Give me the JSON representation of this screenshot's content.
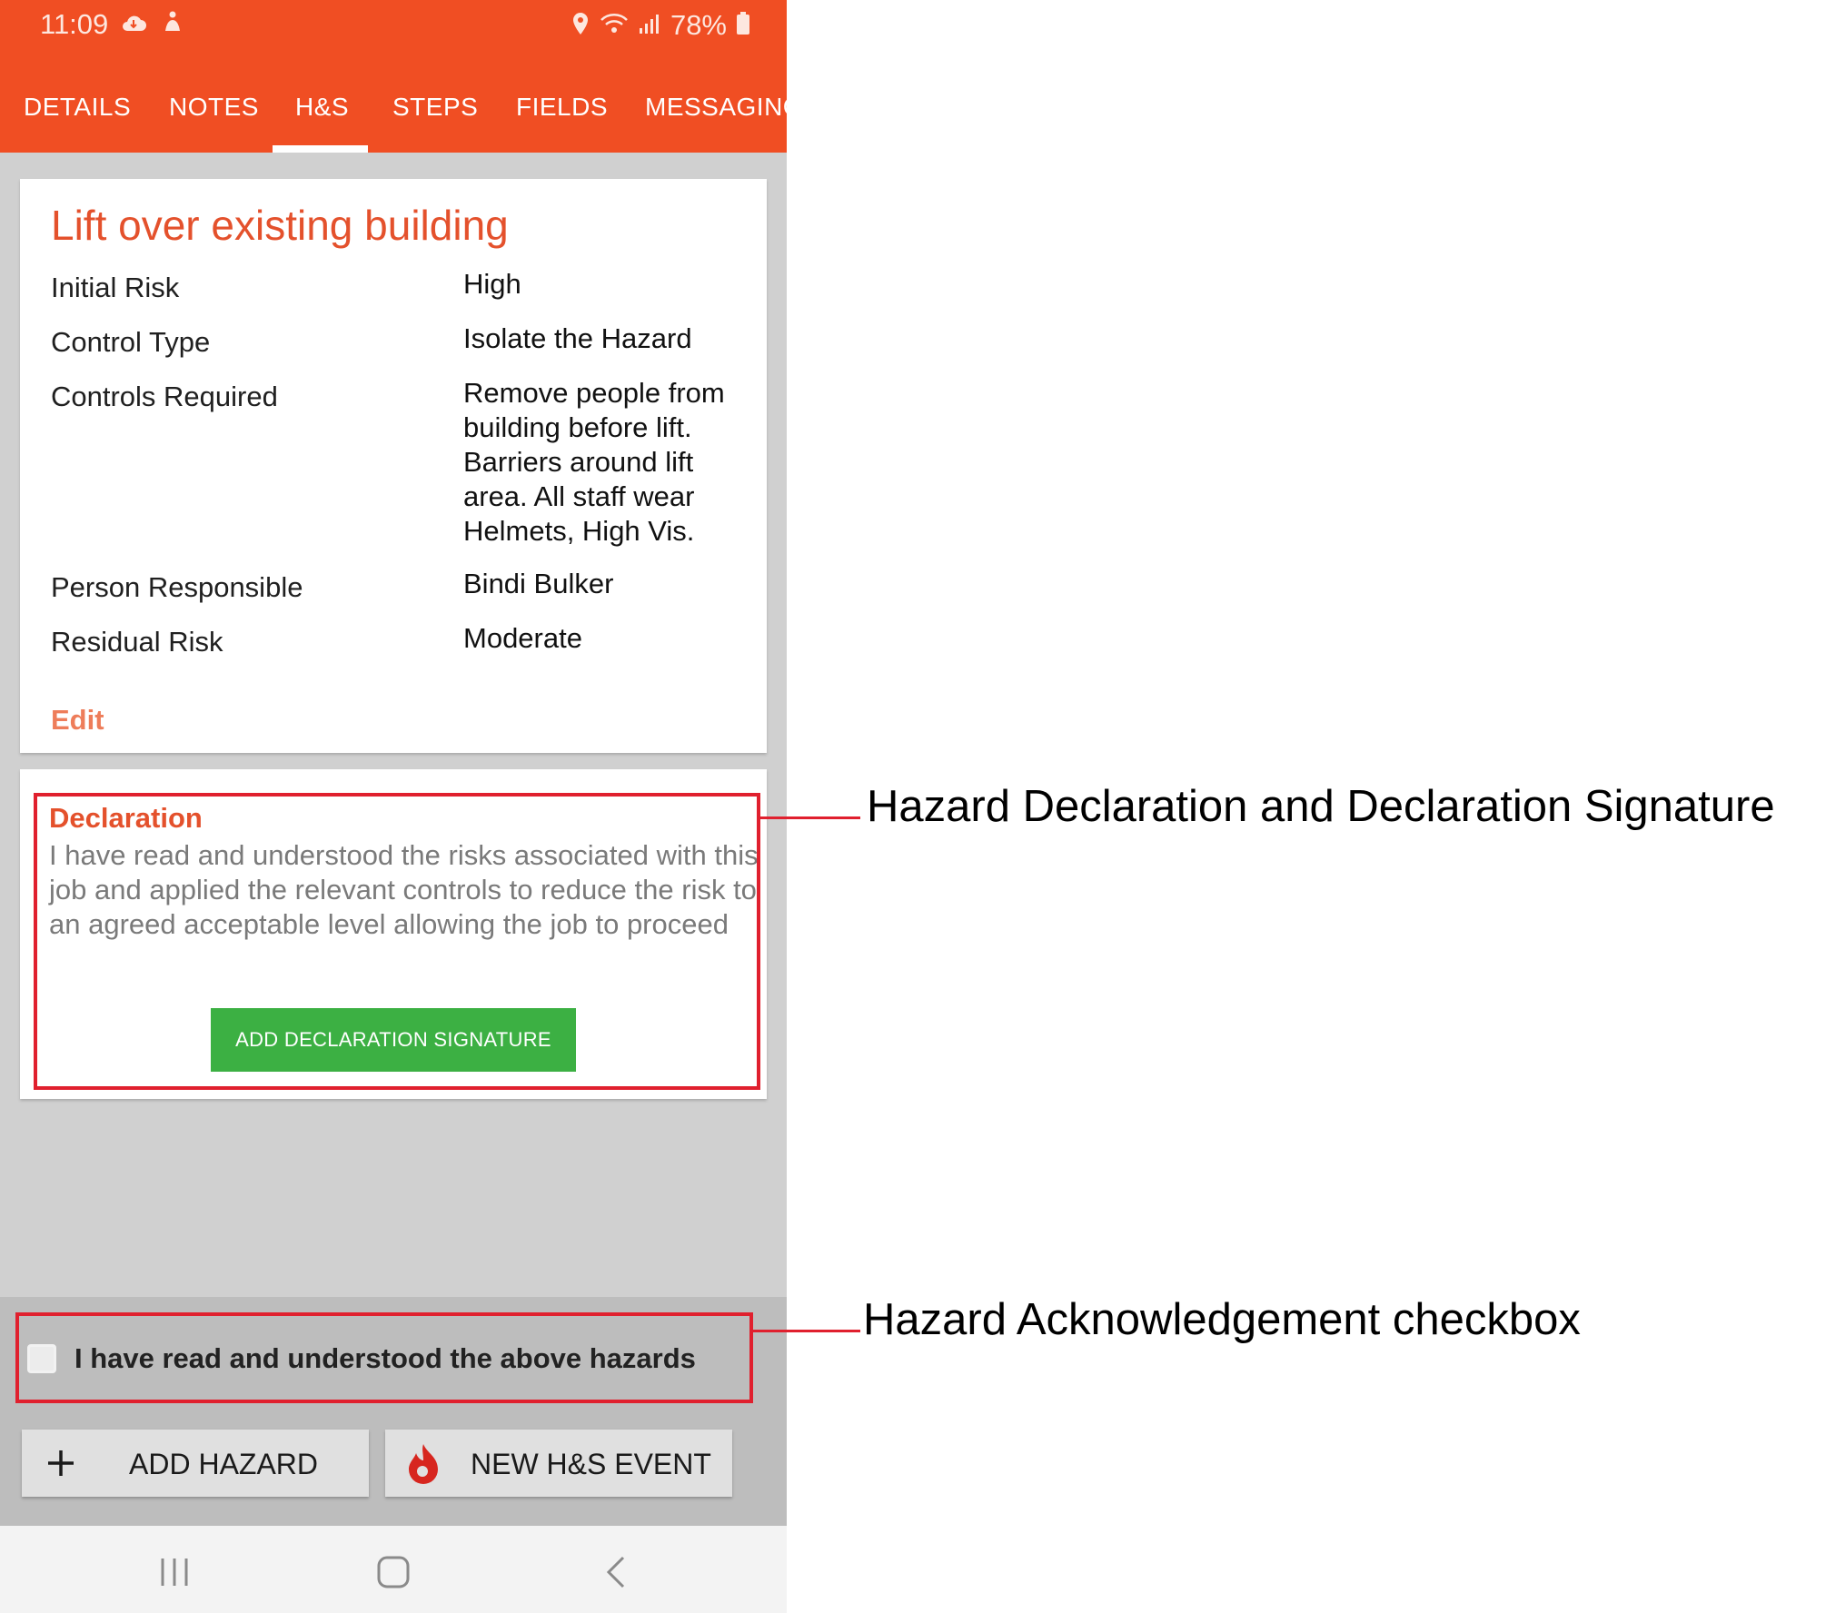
{
  "status_bar": {
    "time": "11:09",
    "battery": "78%"
  },
  "tabs": [
    {
      "label": "DETAILS"
    },
    {
      "label": "NOTES"
    },
    {
      "label": "H&S",
      "active": true
    },
    {
      "label": "STEPS"
    },
    {
      "label": "FIELDS"
    },
    {
      "label": "MESSAGING"
    }
  ],
  "hazard": {
    "title": "Lift over existing building",
    "rows": [
      {
        "label": "Initial Risk",
        "value": "High"
      },
      {
        "label": "Control Type",
        "value": "Isolate the Hazard"
      },
      {
        "label": "Controls Required",
        "value": "Remove people from building before lift. Barriers around lift area. All staff wear Helmets, High Vis."
      },
      {
        "label": "Person Responsible",
        "value": "Bindi Bulker"
      },
      {
        "label": "Residual Risk",
        "value": "Moderate"
      }
    ],
    "edit_label": "Edit"
  },
  "declaration": {
    "title": "Declaration",
    "text": "I have read and understood the risks associated with this job and applied the relevant controls to reduce the risk to an agreed acceptable level allowing the job to proceed",
    "sign_button": "ADD DECLARATION SIGNATURE"
  },
  "acknowledgement": {
    "label": "I have read and understood the above hazards",
    "checked": false
  },
  "actions": {
    "add_hazard": "ADD HAZARD",
    "new_event": "NEW H&S EVENT"
  },
  "annotations": {
    "declaration": "Hazard Declaration and Declaration Signature",
    "acknowledgement": "Hazard Acknowledgement checkbox"
  },
  "colors": {
    "brand": "#f04e23",
    "accent_text": "#e4512c",
    "sign_button": "#3cb043",
    "annotation": "#e0202e"
  }
}
